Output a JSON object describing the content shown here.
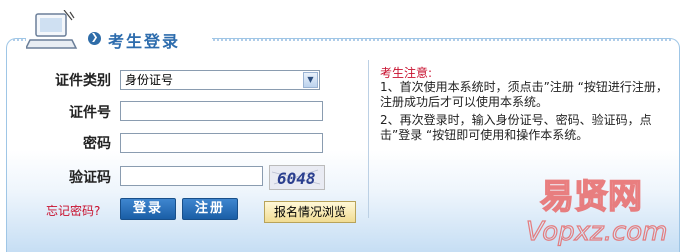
{
  "header": {
    "title": "考生登录"
  },
  "form": {
    "id_type_label": "证件类别",
    "id_type_selected": "身份证号",
    "id_number_label": "证件号",
    "id_number_value": "",
    "password_label": "密码",
    "password_value": "",
    "captcha_label": "验证码",
    "captcha_value": "",
    "captcha_text": "6048",
    "forgot_link": "忘记密码?",
    "login_button": "登录",
    "register_button": "注册",
    "browse_button": "报名情况浏览"
  },
  "notice": {
    "title": "考生注意:",
    "item1": "1、首次使用本系统时，须点击”注册 “按钮进行注册，注册成功后才可以使用本系统。",
    "item2": "2、再次登录时，输入身份证号、密码、验证码，点击”登录 “按钮即可使用和操作本系统。"
  },
  "watermark": {
    "cn": "易贤网",
    "en": "Vopxz.com"
  },
  "colors": {
    "accent": "#2d6cad",
    "notice_red": "#c8102e",
    "button_blue": "#1a5ea6"
  }
}
